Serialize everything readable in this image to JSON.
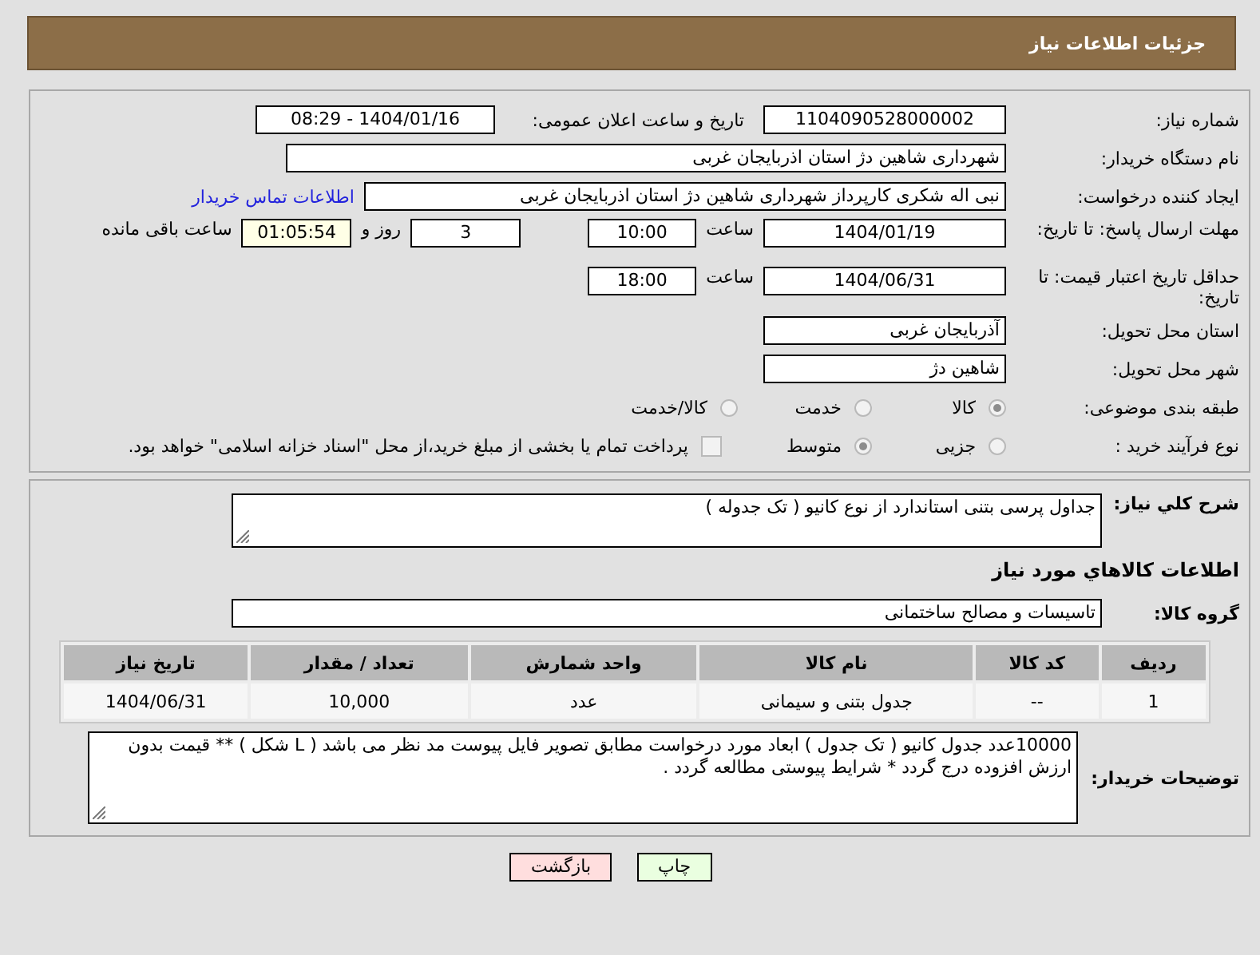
{
  "header": {
    "title": "جزئیات اطلاعات نیاز"
  },
  "details": {
    "need_number": {
      "label": "شماره نیاز:",
      "value": "1104090528000002"
    },
    "announce": {
      "label": "تاریخ و ساعت اعلان عمومی:",
      "value": "1404/01/16 - 08:29"
    },
    "buyer": {
      "label": "نام دستگاه خریدار:",
      "value": "شهرداری شاهین دژ استان اذربایجان غربی"
    },
    "creator": {
      "label": "ایجاد کننده درخواست:",
      "value": "نبی اله شکری کارپرداز شهرداری شاهین دژ استان اذربایجان غربی",
      "link": "اطلاعات تماس خریدار"
    },
    "deadline": {
      "label": "مهلت ارسال پاسخ: تا تاریخ:",
      "date": "1404/01/19",
      "time_label": "ساعت",
      "time": "10:00",
      "days": "3",
      "days_label": "روز و",
      "remaining": "01:05:54",
      "remaining_label": "ساعت باقی مانده"
    },
    "validity": {
      "label": "حداقل تاریخ اعتبار قیمت: تا تاریخ:",
      "date": "1404/06/31",
      "time_label": "ساعت",
      "time": "18:00"
    },
    "province": {
      "label": "استان محل تحویل:",
      "value": "آذربایجان غربی"
    },
    "city": {
      "label": "شهر محل تحویل:",
      "value": "شاهین دژ"
    },
    "category": {
      "label": "طبقه بندی موضوعی:",
      "options": [
        {
          "label": "کالا",
          "selected": true
        },
        {
          "label": "خدمت",
          "selected": false
        },
        {
          "label": "کالا/خدمت",
          "selected": false
        }
      ]
    },
    "process": {
      "label": "نوع فرآیند خرید :",
      "options": [
        {
          "label": "جزیی",
          "selected": false
        },
        {
          "label": "متوسط",
          "selected": true
        }
      ],
      "treasury": {
        "label": "پرداخت تمام یا بخشی از مبلغ خرید،از محل \"اسناد خزانه اسلامی\" خواهد بود.",
        "checked": false
      }
    }
  },
  "need": {
    "summary": {
      "label": "شرح کلي نياز:",
      "value": "جداول پرسی بتنی استاندارد  از نوع کانیو ( تک جدوله )"
    },
    "section_title": "اطلاعات کالاهاي مورد نياز",
    "group": {
      "label": "گروه کالا:",
      "value": "تاسیسات و مصالح ساختمانی"
    },
    "table": {
      "columns": [
        "ردیف",
        "کد کالا",
        "نام کالا",
        "واحد شمارش",
        "تعداد / مقدار",
        "تاریخ نیاز"
      ],
      "rows": [
        [
          "1",
          "--",
          "جدول بتنی و سیمانی",
          "عدد",
          "10,000",
          "1404/06/31"
        ]
      ]
    },
    "buyer_notes": {
      "label": "توضیحات خریدار:",
      "value": "10000عدد جدول کانیو ( تک جدول ) ابعاد مورد درخواست مطابق تصویر فایل پیوست مد نظر می باشد ( L  شکل ) ** قیمت بدون ارزش افزوده درج گردد * شرایط پیوستی مطالعه گردد ."
    }
  },
  "buttons": [
    {
      "label": "چاپ",
      "kind": "print"
    },
    {
      "label": "بازگشت",
      "kind": "back"
    }
  ]
}
